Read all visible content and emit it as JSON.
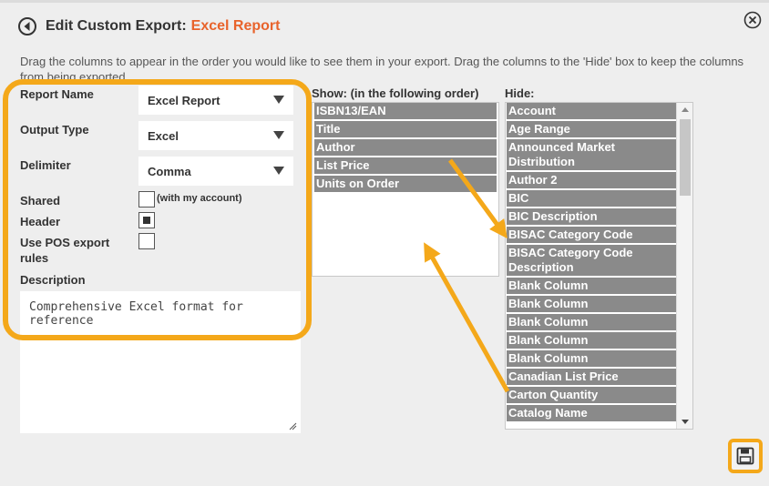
{
  "header": {
    "title_static": "Edit Custom Export:",
    "title_accent": "Excel Report"
  },
  "instructions": "Drag the columns to appear in the order you would like to see them in your export. Drag the columns to the 'Hide' box to keep the columns from being exported.",
  "form": {
    "report_name_label": "Report Name",
    "report_name_value": "Excel Report",
    "output_type_label": "Output Type",
    "output_type_value": "Excel",
    "delimiter_label": "Delimiter",
    "delimiter_value": "Comma",
    "shared_label": "Shared",
    "shared_note": "(with my account)",
    "shared_checked": false,
    "header_label": "Header",
    "header_checked": true,
    "pos_label_line1": "Use POS export",
    "pos_label_line2": "rules",
    "pos_checked": false,
    "description_label": "Description",
    "description_value": "Comprehensive Excel format for reference"
  },
  "show": {
    "heading": "Show: (in the following order)",
    "items": [
      "ISBN13/EAN",
      "Title",
      "Author",
      "List Price",
      "Units on Order"
    ]
  },
  "hide": {
    "heading": "Hide:",
    "items": [
      [
        "Account"
      ],
      [
        "Age Range"
      ],
      [
        "Announced Market",
        "Distribution"
      ],
      [
        "Author 2"
      ],
      [
        "BIC"
      ],
      [
        "BIC Description"
      ],
      [
        "BISAC Category Code"
      ],
      [
        "BISAC Category Code",
        "Description"
      ],
      [
        "Blank Column"
      ],
      [
        "Blank Column"
      ],
      [
        "Blank Column"
      ],
      [
        "Blank Column"
      ],
      [
        "Blank Column"
      ],
      [
        "Canadian List Price"
      ],
      [
        "Carton Quantity"
      ],
      [
        "Catalog Name"
      ]
    ]
  },
  "colors": {
    "accent": "#e8632b",
    "highlight": "#f4a81a",
    "item_bg": "#8a8a8a"
  },
  "icons": {
    "back": "back-circle-icon",
    "close": "close-circle-icon",
    "save": "floppy-disk-icon"
  }
}
